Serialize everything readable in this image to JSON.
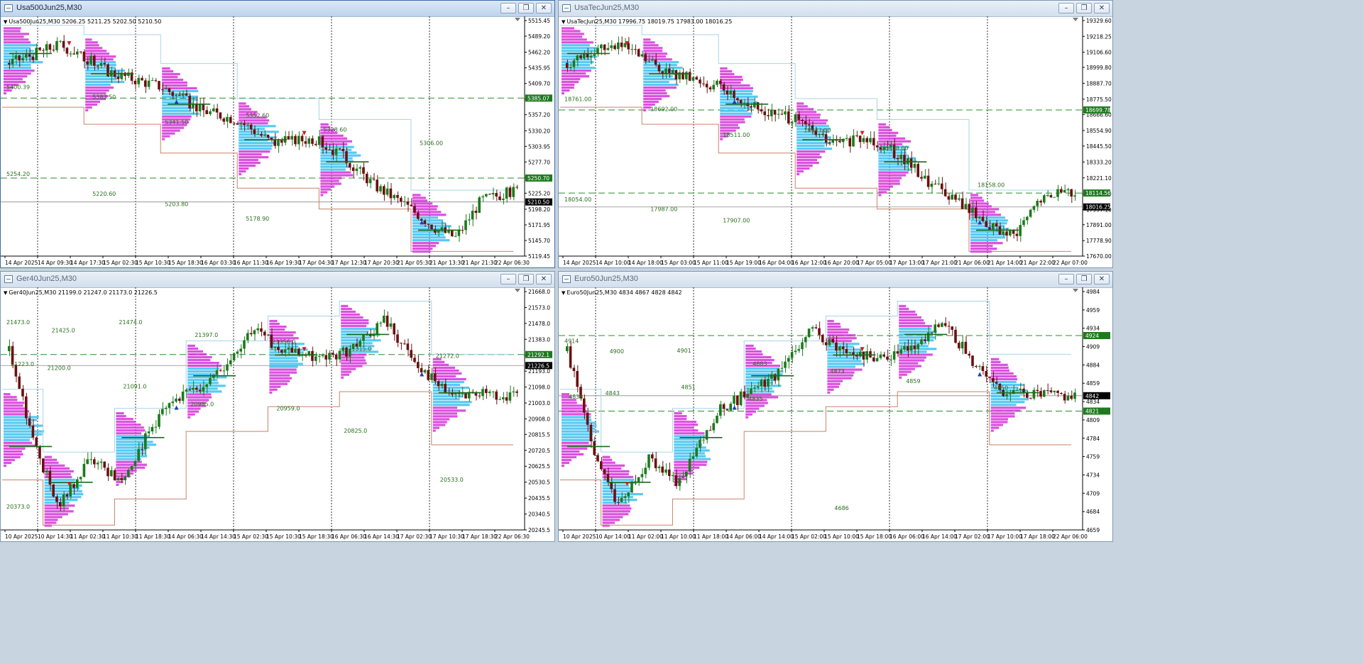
{
  "windows": [
    {
      "id": "usa500",
      "title": "Usa500Jun25,M30",
      "active": true,
      "symbol_line": "Usa500Jun25,M30  5206.25 5211.25 5202.50 5210.50",
      "price_labels": [
        "5515.45",
        "5489.20",
        "5462.20",
        "5435.95",
        "5409.70",
        "5383.45",
        "5357.20",
        "5330.20",
        "5303.95",
        "5277.70",
        "5251.45",
        "5225.20",
        "5198.20",
        "5171.95",
        "5145.70",
        "5119.45"
      ],
      "time_labels": [
        "14 Apr 2025",
        "14 Apr 09:30",
        "14 Apr 17:30",
        "15 Apr 02:30",
        "15 Apr 10:30",
        "15 Apr 18:30",
        "16 Apr 03:30",
        "16 Apr 11:30",
        "16 Apr 19:30",
        "17 Apr 04:30",
        "17 Apr 12:30",
        "17 Apr 20:30",
        "21 Apr 05:30",
        "21 Apr 13:30",
        "21 Apr 21:30",
        "22 Apr 06:30"
      ],
      "level_tags": [
        {
          "price": 5385.07,
          "text": "5385.07",
          "color": "#1f7a1f"
        },
        {
          "price": 5250.7,
          "text": "5250.70",
          "color": "#1f7a1f"
        },
        {
          "price": 5210.5,
          "text": "5210.50",
          "color": "#000000"
        }
      ],
      "dashed_levels": [
        5385.07,
        5250.7
      ],
      "current_price": 5210.5,
      "annotations": [
        {
          "price": 5400.39,
          "text": "5400.39"
        },
        {
          "price": 5383.5,
          "text": "5383.50"
        },
        {
          "price": 5341.5,
          "text": "5341.50"
        },
        {
          "price": 5352.6,
          "text": "5352.60"
        },
        {
          "price": 5328.6,
          "text": "5328.60"
        },
        {
          "price": 5306.0,
          "text": "5306.00"
        },
        {
          "price": 5254.2,
          "text": "5254.20"
        },
        {
          "price": 5220.6,
          "text": "5220.60"
        },
        {
          "price": 5203.8,
          "text": "5203.80"
        },
        {
          "price": 5178.9,
          "text": "5178.90"
        }
      ]
    },
    {
      "id": "usatec",
      "title": "UsaTecJun25,M30",
      "active": false,
      "symbol_line": "UsaTecJun25,M30  17996.75 18019.75 17983.00 18016.25",
      "price_labels": [
        "19329.60",
        "19218.25",
        "19106.60",
        "18999.80",
        "18887.70",
        "18775.50",
        "18666.60",
        "18554.90",
        "18445.50",
        "18333.20",
        "18221.10",
        "18109.50",
        "17997.10",
        "17891.00",
        "17778.90",
        "17670.00"
      ],
      "time_labels": [
        "14 Apr 2025",
        "14 Apr 10:00",
        "14 Apr 18:00",
        "15 Apr 03:00",
        "15 Apr 11:00",
        "15 Apr 19:00",
        "16 Apr 04:00",
        "16 Apr 12:00",
        "16 Apr 20:00",
        "17 Apr 05:00",
        "17 Apr 13:00",
        "17 Apr 21:00",
        "21 Apr 06:00",
        "21 Apr 14:00",
        "21 Apr 22:00",
        "22 Apr 07:00"
      ],
      "level_tags": [
        {
          "price": 18699.78,
          "text": "18699.78",
          "color": "#1f7a1f"
        },
        {
          "price": 18114.56,
          "text": "18114.56",
          "color": "#1f7a1f"
        },
        {
          "price": 18016.25,
          "text": "18016.25",
          "color": "#000000"
        }
      ],
      "dashed_levels": [
        18699.78,
        18114.56
      ],
      "current_price": 18016.25,
      "annotations": [
        {
          "price": 18761.0,
          "text": "18761.00"
        },
        {
          "price": 18692.0,
          "text": "18692.00"
        },
        {
          "price": 18511.0,
          "text": "18511.00"
        },
        {
          "price": 18543.0,
          "text": "18543.00"
        },
        {
          "price": 18418.0,
          "text": "18418.00"
        },
        {
          "price": 18158.0,
          "text": "18158.00"
        },
        {
          "price": 18054.0,
          "text": "18054.00"
        },
        {
          "price": 17987.0,
          "text": "17987.00"
        },
        {
          "price": 17907.0,
          "text": "17907.00"
        }
      ]
    },
    {
      "id": "ger40",
      "title": "Ger40Jun25,M30",
      "active": false,
      "symbol_line": "Ger40Jun25,M30  21199.0 21247.0 21173.0 21226.5",
      "price_labels": [
        "21668.0",
        "21573.0",
        "21478.0",
        "21383.0",
        "21288.0",
        "21193.0",
        "21098.0",
        "21003.0",
        "20908.0",
        "20815.5",
        "20720.5",
        "20625.5",
        "20530.5",
        "20435.5",
        "20340.5",
        "20245.5"
      ],
      "time_labels": [
        "10 Apr 2025",
        "10 Apr 14:30",
        "11 Apr 02:30",
        "11 Apr 10:30",
        "11 Apr 18:30",
        "14 Apr 06:30",
        "14 Apr 14:30",
        "15 Apr 02:30",
        "15 Apr 10:30",
        "15 Apr 18:30",
        "16 Apr 06:30",
        "16 Apr 14:30",
        "17 Apr 02:30",
        "17 Apr 10:30",
        "17 Apr 18:30",
        "22 Apr 06:30"
      ],
      "level_tags": [
        {
          "price": 21292.1,
          "text": "21292.1",
          "color": "#1f7a1f"
        },
        {
          "price": 21226.5,
          "text": "21226.5",
          "color": "#000000"
        }
      ],
      "dashed_levels": [
        21292.1
      ],
      "current_price": 21226.5,
      "annotations": [
        {
          "price": 21473.0,
          "text": "21473.0"
        },
        {
          "price": 21425.0,
          "text": "21425.0"
        },
        {
          "price": 21474.0,
          "text": "21474.0"
        },
        {
          "price": 21397.0,
          "text": "21397.0"
        },
        {
          "price": 21356.0,
          "text": "21356.0"
        },
        {
          "price": 21315.0,
          "text": "21315.0"
        },
        {
          "price": 21272.0,
          "text": "21272.0"
        },
        {
          "price": 21223.0,
          "text": "21223.0"
        },
        {
          "price": 21200.0,
          "text": "21200.0"
        },
        {
          "price": 21091.0,
          "text": "21091.0"
        },
        {
          "price": 20985.0,
          "text": "20985.0"
        },
        {
          "price": 20959.0,
          "text": "20959.0"
        },
        {
          "price": 20825.0,
          "text": "20825.0"
        },
        {
          "price": 20533.0,
          "text": "20533.0"
        },
        {
          "price": 20373.0,
          "text": "20373.0"
        }
      ]
    },
    {
      "id": "euro50",
      "title": "Euro50Jun25,M30",
      "active": false,
      "symbol_line": "Euro50Jun25,M30  4834 4867 4828 4842",
      "price_labels": [
        "4984",
        "4959",
        "4934",
        "4909",
        "4884",
        "4859",
        "4834",
        "4809",
        "4784",
        "4759",
        "4734",
        "4709",
        "4684",
        "4659"
      ],
      "time_labels": [
        "10 Apr 2025",
        "10 Apr 14:00",
        "11 Apr 02:00",
        "11 Apr 10:00",
        "11 Apr 18:00",
        "14 Apr 06:00",
        "14 Apr 14:00",
        "15 Apr 02:00",
        "15 Apr 10:00",
        "15 Apr 18:00",
        "16 Apr 06:00",
        "16 Apr 14:00",
        "17 Apr 02:00",
        "17 Apr 10:00",
        "17 Apr 18:00",
        "22 Apr 06:00"
      ],
      "level_tags": [
        {
          "price": 4924,
          "text": "4924",
          "color": "#1f7a1f"
        },
        {
          "price": 4842,
          "text": "4842",
          "color": "#000000"
        },
        {
          "price": 4821,
          "text": "4821",
          "color": "#1f7a1f"
        }
      ],
      "dashed_levels": [
        4924,
        4821
      ],
      "current_price": 4842,
      "annotations": [
        {
          "price": 4914,
          "text": "4914"
        },
        {
          "price": 4900,
          "text": "4900"
        },
        {
          "price": 4901,
          "text": "4901"
        },
        {
          "price": 4883,
          "text": "4883"
        },
        {
          "price": 4873,
          "text": "4873"
        },
        {
          "price": 4859,
          "text": "4859"
        },
        {
          "price": 4850,
          "text": "4850"
        },
        {
          "price": 4838,
          "text": "4838"
        },
        {
          "price": 4843,
          "text": "4843"
        },
        {
          "price": 4851,
          "text": "4851"
        },
        {
          "price": 4835,
          "text": "4835"
        },
        {
          "price": 4686,
          "text": "4686"
        }
      ]
    }
  ],
  "window_buttons": {
    "minimize": "–",
    "restore": "❐",
    "close": "✕"
  },
  "colors": {
    "bull": "#1b7a1b",
    "bear": "#6b1010",
    "profile_low": "#d433d8",
    "profile_high": "#3ac0f0",
    "value_high": "#a9d4e6",
    "value_low": "#c9826a",
    "level": "#2e8b2e",
    "grid": "#000000"
  }
}
